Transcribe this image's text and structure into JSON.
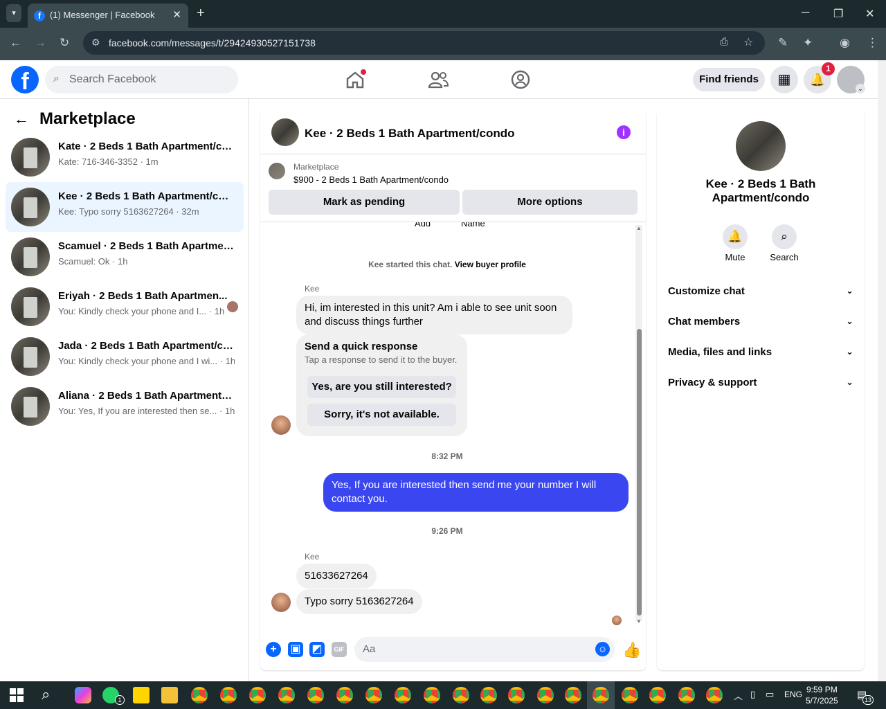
{
  "browser": {
    "tab_title": "(1) Messenger | Facebook",
    "url": "facebook.com/messages/t/29424930527151738"
  },
  "header": {
    "search_placeholder": "Search Facebook",
    "find_friends": "Find friends",
    "notif_count": "1"
  },
  "left": {
    "title": "Marketplace",
    "conversations": [
      {
        "name": "Kate · 2 Beds 1 Bath Apartment/co...",
        "snippet": "Kate: 716-346-3352 · 1m"
      },
      {
        "name": "Kee · 2 Beds 1 Bath Apartment/con...",
        "snippet": "Kee: Typo sorry 5163627264 · 32m"
      },
      {
        "name": "Scamuel · 2 Beds 1 Bath Apartmen...",
        "snippet": "Scamuel: Ok · 1h"
      },
      {
        "name": "Eriyah · 2 Beds 1 Bath Apartmen...",
        "snippet": "You: Kindly check your phone and I... · 1h"
      },
      {
        "name": "Jada · 2 Beds 1 Bath Apartment/co...",
        "snippet": "You: Kindly check your phone and I wi... · 1h"
      },
      {
        "name": "Aliana · 2 Beds 1 Bath Apartment/c...",
        "snippet": "You: Yes, If you are interested then se...  · 1h"
      }
    ]
  },
  "chat": {
    "title": "Kee · 2 Beds 1 Bath Apartment/condo",
    "listing_source": "Marketplace",
    "listing_title": "$900 - 2 Beds 1 Bath Apartment/condo",
    "mark_pending": "Mark as pending",
    "more_options": "More options",
    "cut_add": "Add",
    "cut_name": "Name",
    "started": "Kee started this chat.",
    "view_profile": "View buyer profile",
    "sender": "Kee",
    "msg1": "Hi, im interested in this unit? Am i able to see unit soon and discuss things further",
    "quick_title": "Send a quick response",
    "quick_sub": "Tap a response to send it to the buyer.",
    "quick1": "Yes, are you still interested?",
    "quick2": "Sorry, it's not available.",
    "time1": "8:32 PM",
    "my_msg": "Yes, If you are interested then send me your number I will contact you.",
    "time2": "9:26 PM",
    "msg2": "51633627264",
    "msg3": "Typo sorry 5163627264",
    "input_placeholder": "Aa"
  },
  "right": {
    "name": "Kee · 2 Beds 1 Bath Apartment/condo",
    "mute": "Mute",
    "search": "Search",
    "sections": [
      "Customize chat",
      "Chat members",
      "Media, files and links",
      "Privacy & support"
    ]
  },
  "taskbar": {
    "time": "9:59 PM",
    "date": "5/7/2025",
    "lang": "ENG",
    "whatsapp_count": "1",
    "notif_count": "13"
  }
}
